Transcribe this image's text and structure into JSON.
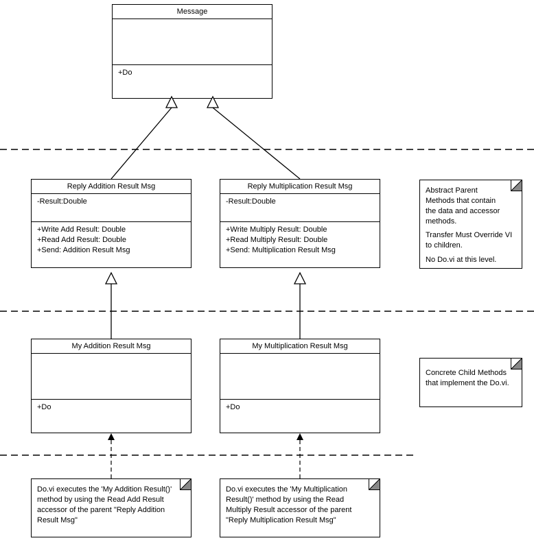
{
  "classes": {
    "message": {
      "name": "Message",
      "ops": "+Do"
    },
    "replyAdd": {
      "name": "Reply Addition Result Msg",
      "attrs": "-Result:Double",
      "op1": "+Write Add Result: Double",
      "op2": "+Read Add Result: Double",
      "op3": "+Send: Addition Result Msg"
    },
    "replyMul": {
      "name": "Reply Multiplication Result Msg",
      "attrs": "-Result:Double",
      "op1": "+Write Multiply Result: Double",
      "op2": "+Read Multiply Result: Double",
      "op3": "+Send: Multiplication Result Msg"
    },
    "myAdd": {
      "name": "My Addition Result Msg",
      "ops": "+Do"
    },
    "myMul": {
      "name": "My Multiplication Result Msg",
      "ops": "+Do"
    }
  },
  "notes": {
    "abstract": {
      "l1": "Abstract Parent",
      "l2": "Methods that contain",
      "l3": "the data and accessor",
      "l4": "methods.",
      "l5": "Transfer Must Override VI",
      "l6": "to children.",
      "l7": "No Do.vi at this level."
    },
    "concrete": {
      "l1": "Concrete Child Methods",
      "l2": "that implement the Do.vi."
    },
    "doAdd": {
      "text": "Do.vi executes the 'My Addition Result()' method by using the Read Add Result accessor of the parent \"Reply Addition Result Msg\""
    },
    "doMul": {
      "text": "Do.vi executes the 'My Multiplication Result()' method by using the Read Multiply Result accessor of the parent \"Reply Multiplication Result Msg\""
    }
  }
}
